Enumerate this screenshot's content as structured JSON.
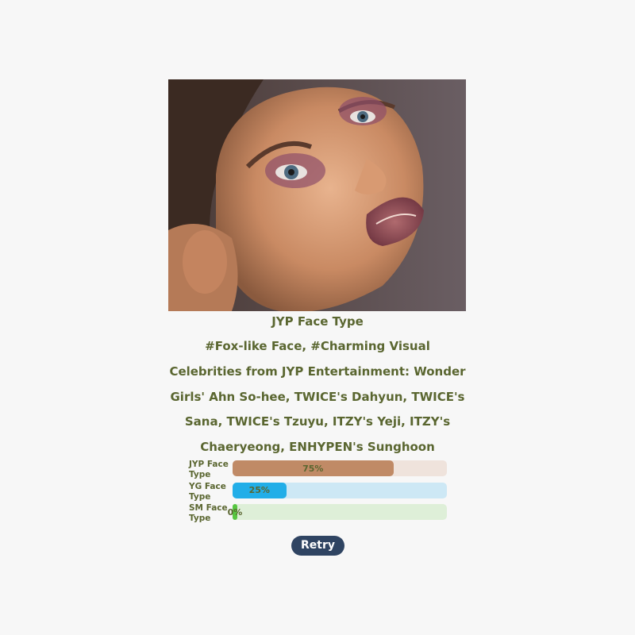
{
  "result": {
    "title": "JYP Face Type",
    "tags": "#Fox-like Face, #Charming Visual",
    "celebrities": "Celebrities from JYP Entertainment: Wonder Girls' Ahn So-hee, TWICE's Dahyun, TWICE's Sana, TWICE's Tzuyu, ITZY's Yeji, ITZY's Chaeryeong, ENHYPEN's Sunghoon"
  },
  "bars": [
    {
      "label": "JYP Face Type",
      "percent_label": "75%",
      "value": 75,
      "fill_color": "#c08a66",
      "track_color": "#efe3dc"
    },
    {
      "label": "YG Face Type",
      "percent_label": "25%",
      "value": 25,
      "fill_color": "#22aee8",
      "track_color": "#cde8f5"
    },
    {
      "label": "SM Face Type",
      "percent_label": "0%",
      "value": 0,
      "fill_color": "#57c641",
      "track_color": "#deefd8"
    }
  ],
  "retry_label": "Retry",
  "colors": {
    "background": "#f7f7f7",
    "text": "#5a6630",
    "retry_button": "#2f4462"
  }
}
